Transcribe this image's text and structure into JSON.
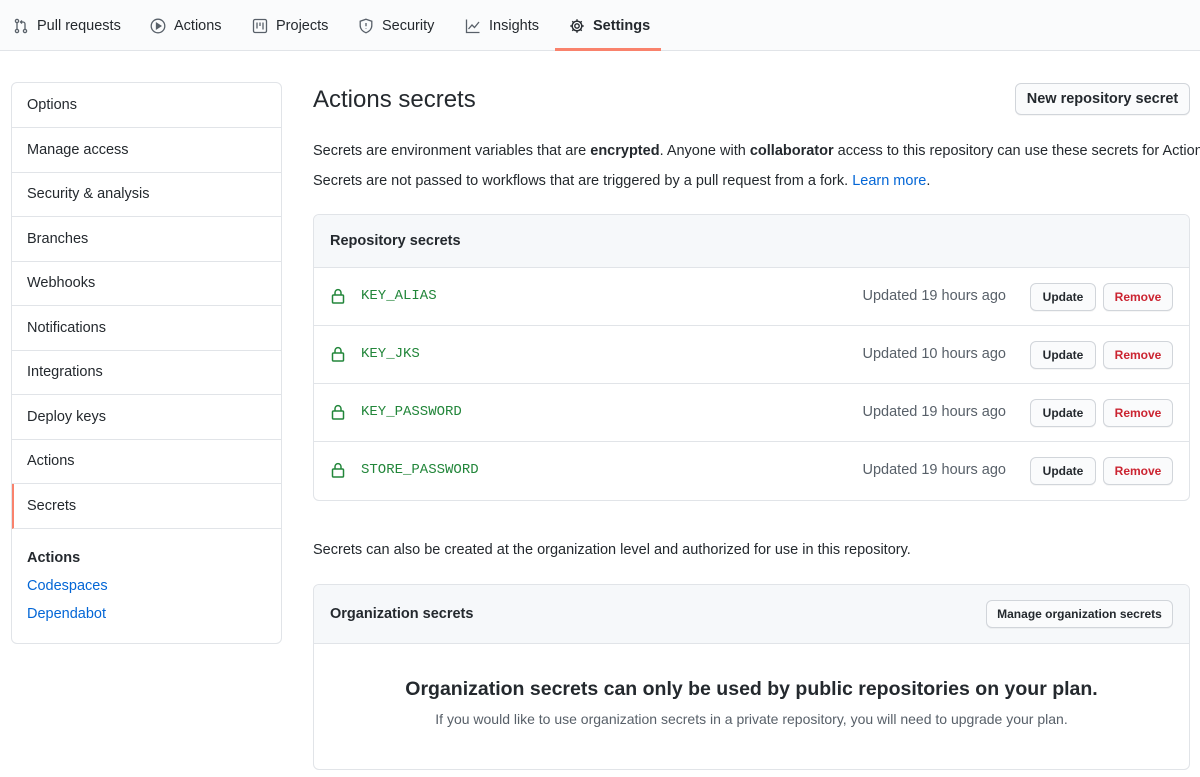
{
  "nav": {
    "tabs": [
      {
        "label": "Pull requests",
        "icon": "pull-request-icon"
      },
      {
        "label": "Actions",
        "icon": "play-icon"
      },
      {
        "label": "Projects",
        "icon": "project-icon"
      },
      {
        "label": "Security",
        "icon": "shield-icon"
      },
      {
        "label": "Insights",
        "icon": "graph-icon"
      },
      {
        "label": "Settings",
        "icon": "gear-icon",
        "selected": true
      }
    ]
  },
  "sidebar": {
    "items": [
      {
        "label": "Options"
      },
      {
        "label": "Manage access"
      },
      {
        "label": "Security & analysis"
      },
      {
        "label": "Branches"
      },
      {
        "label": "Webhooks"
      },
      {
        "label": "Notifications"
      },
      {
        "label": "Integrations"
      },
      {
        "label": "Deploy keys"
      },
      {
        "label": "Actions"
      },
      {
        "label": "Secrets",
        "selected": true
      }
    ],
    "sub_heading": "Actions",
    "sub_links": [
      {
        "label": "Codespaces"
      },
      {
        "label": "Dependabot"
      }
    ]
  },
  "main": {
    "title": "Actions secrets",
    "new_secret_button": "New repository secret",
    "intro": {
      "p1_a": "Secrets are environment variables that are ",
      "p1_b": "encrypted",
      "p1_c": ". Anyone with ",
      "p1_d": "collaborator",
      "p1_e": " access to this repository can use these secrets for Actions.",
      "p2_a": "Secrets are not passed to workflows that are triggered by a pull request from a fork. ",
      "p2_link": "Learn more",
      "p2_end": "."
    },
    "repo_secrets": {
      "header": "Repository secrets",
      "update_label": "Update",
      "remove_label": "Remove",
      "rows": [
        {
          "name": "KEY_ALIAS",
          "updated": "Updated 19 hours ago"
        },
        {
          "name": "KEY_JKS",
          "updated": "Updated 10 hours ago"
        },
        {
          "name": "KEY_PASSWORD",
          "updated": "Updated 19 hours ago"
        },
        {
          "name": "STORE_PASSWORD",
          "updated": "Updated 19 hours ago"
        }
      ]
    },
    "org_note": "Secrets can also be created at the organization level and authorized for use in this repository.",
    "org_secrets": {
      "header": "Organization secrets",
      "manage_button": "Manage organization secrets",
      "blank_title": "Organization secrets can only be used by public repositories on your plan.",
      "blank_text": "If you would like to use organization secrets in a private repository, you will need to upgrade your plan."
    }
  },
  "colors": {
    "accent_underline": "#f9826c",
    "link": "#0366d6",
    "secret_name": "#22863a",
    "danger": "#cb2431"
  }
}
